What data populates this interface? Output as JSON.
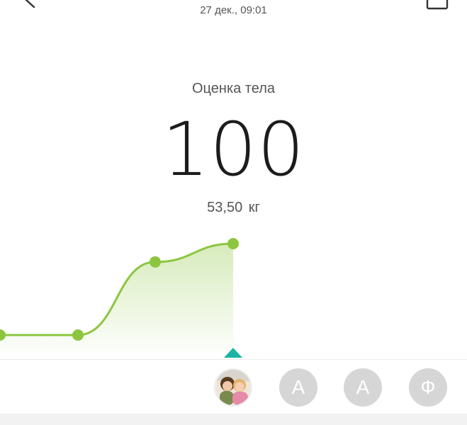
{
  "header": {
    "date": "27 дек., 09:01",
    "back_icon": "chevron-left-icon",
    "calendar_icon": "calendar-icon"
  },
  "score": {
    "label": "Оценка тела",
    "value": "100",
    "weight": "53,50  кг"
  },
  "colors": {
    "accent": "#8cc63f",
    "pointer": "#1ab6a3",
    "avatar_bg": "#d6d6d6"
  },
  "chart_data": {
    "type": "line",
    "title": "",
    "xlabel": "",
    "ylabel": "",
    "series": [
      {
        "values": [
          0,
          0,
          0.8,
          1
        ]
      }
    ],
    "selected_index": 3
  },
  "users": [
    {
      "type": "photo",
      "initial": "",
      "selected": true
    },
    {
      "type": "initial",
      "initial": "А",
      "selected": false
    },
    {
      "type": "initial",
      "initial": "А",
      "selected": false
    },
    {
      "type": "initial",
      "initial": "Ф",
      "selected": false
    }
  ]
}
